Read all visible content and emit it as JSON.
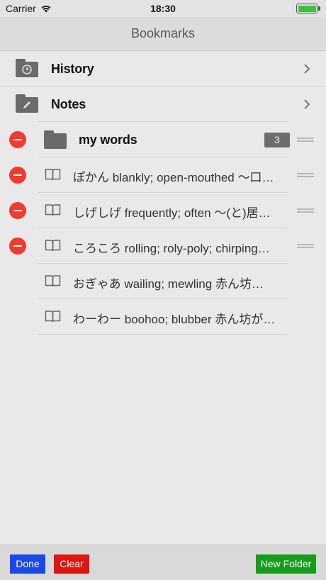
{
  "status_bar": {
    "carrier": "Carrier",
    "time": "18:30"
  },
  "nav": {
    "title": "Bookmarks"
  },
  "folders": [
    {
      "label": "History",
      "icon": "clock-icon"
    },
    {
      "label": "Notes",
      "icon": "pencil-icon"
    }
  ],
  "my_words": {
    "label": "my words",
    "count": "3"
  },
  "items": [
    {
      "text": "ぽかん blankly; open-mouthed 〜口…",
      "deletable": true
    },
    {
      "text": "しげしげ frequently; often 〜(と)居…",
      "deletable": true
    },
    {
      "text": "ころころ rolling; roly-poly; chirping…",
      "deletable": true
    },
    {
      "text": "おぎゃあ wailing; mewling 赤ん坊…",
      "deletable": false
    },
    {
      "text": "わーわー boohoo; blubber 赤ん坊が…",
      "deletable": false
    }
  ],
  "toolbar": {
    "done_label": "Done",
    "clear_label": "Clear",
    "new_folder_label": "New Folder"
  },
  "colors": {
    "done": "#1a49e8",
    "clear": "#e0150f",
    "new_folder": "#169c1b",
    "delete": "#f23a2f"
  }
}
